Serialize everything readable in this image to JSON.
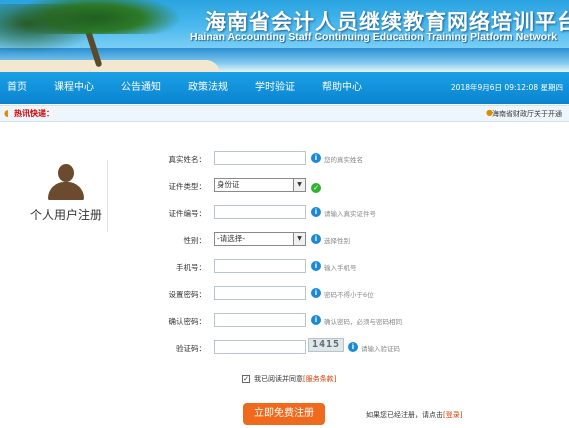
{
  "banner": {
    "title": "海南省会计人员继续教育网络培训平台",
    "subtitle": "Hainan Accounting Staff Continuing Education Training Platform Network"
  },
  "nav": {
    "items": [
      "首页",
      "课程中心",
      "公告通知",
      "政策法规",
      "学时验证",
      "帮助中心"
    ],
    "datetime": "2018年9月6日 09:12:08 星期四"
  },
  "ticker": {
    "label": "热讯快递：",
    "text": "海南省财政厅关于开通"
  },
  "panel": {
    "title": "个人用户注册"
  },
  "form": {
    "name_label": "真实姓名：",
    "name_hint": "您的真实姓名",
    "idtype_label": "证件类型：",
    "idtype_value": "身份证",
    "idnum_label": "证件编号：",
    "idnum_hint": "请输入真实证件号",
    "gender_label": "性别：",
    "gender_value": "-请选择-",
    "gender_hint": "选择性别",
    "phone_label": "手机号：",
    "phone_hint": "输入手机号",
    "pwd_label": "设置密码：",
    "pwd_hint": "密码不得小于6位",
    "pwd2_label": "确认密码：",
    "pwd2_hint": "确认密码，必须与密码相同",
    "captcha_label": "验证码：",
    "captcha_value": "1415",
    "captcha_hint": "请输入验证码",
    "agree_text": "我已阅读并同意",
    "agree_link": "[服务条款]",
    "submit_label": "立即免费注册",
    "login_text": "如果您已经注册，请点击",
    "login_link": "[登录]"
  },
  "colors": {
    "nav": "#0b84cf",
    "accent": "#f06a1e",
    "info": "#1a8ad6",
    "ok": "#33b133"
  }
}
